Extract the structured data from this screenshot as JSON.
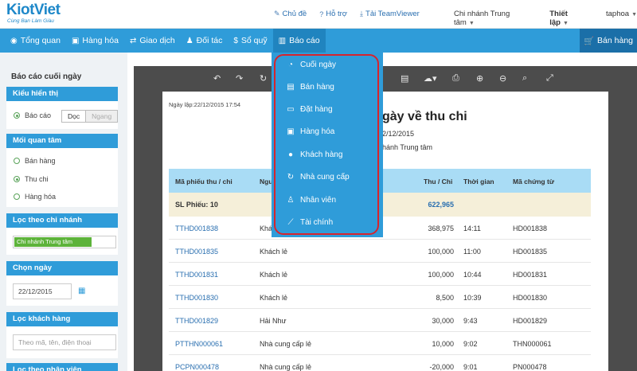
{
  "app": {
    "logo": "KiotViet",
    "slogan": "Cùng Bạn Làm Giàu"
  },
  "toplinks": [
    {
      "label": "Chủ đề",
      "icon": "brush-icon"
    },
    {
      "label": "Hỗ trợ",
      "icon": "help-circle-icon"
    },
    {
      "label": "Tải TeamViewer",
      "icon": "download-icon"
    }
  ],
  "topright": {
    "branch": "Chi nhánh Trung tâm",
    "settings": "Thiết lập",
    "user": "taphoa"
  },
  "nav": {
    "items": [
      {
        "label": "Tổng quan",
        "icon": "eye-icon"
      },
      {
        "label": "Hàng hóa",
        "icon": "box-icon"
      },
      {
        "label": "Giao dịch",
        "icon": "exchange-icon"
      },
      {
        "label": "Đối tác",
        "icon": "person-icon"
      },
      {
        "label": "Sổ quỹ",
        "icon": "dollar-icon"
      },
      {
        "label": "Báo cáo",
        "icon": "bar-chart-icon"
      }
    ],
    "sell": "Bán hàng"
  },
  "sidebar": {
    "title": "Báo cáo cuối ngày",
    "display": {
      "header": "Kiểu hiển thị",
      "option": "Báo cáo",
      "seg_vertical": "Dọc",
      "seg_horizontal": "Ngang"
    },
    "concern": {
      "header": "Mối quan tâm",
      "options": [
        "Bán hàng",
        "Thu chi",
        "Hàng hóa"
      ]
    },
    "branch_filter": {
      "header": "Lọc theo chi nhánh",
      "tag": "Chi nhánh Trung tâm"
    },
    "date": {
      "header": "Chọn ngày",
      "value": "22/12/2015"
    },
    "customer": {
      "header": "Lọc khách hàng",
      "placeholder": "Theo mã, tên, điện thoại"
    },
    "staff": {
      "header": "Lọc theo nhân viên"
    }
  },
  "report": {
    "print_date": "Ngày lập:22/12/2015 17:54",
    "title": "gày về thu chi",
    "sub_date": "2/12/2015",
    "sub_branch": "hánh Trung tâm",
    "columns": [
      "Mã phiếu thu / chi",
      "Ngư",
      "Thu / Chi",
      "Thời gian",
      "Mã chứng từ"
    ],
    "summary": {
      "label": "SL Phiếu: 10",
      "total": "622,965"
    },
    "rows": [
      {
        "code": "TTHD001838",
        "person": "Khá",
        "amount": "368,975",
        "time": "14:11",
        "ref": "HD001838"
      },
      {
        "code": "TTHD001835",
        "person": "Khách lẻ",
        "amount": "100,000",
        "time": "11:00",
        "ref": "HD001835"
      },
      {
        "code": "TTHD001831",
        "person": "Khách lẻ",
        "amount": "100,000",
        "time": "10:44",
        "ref": "HD001831"
      },
      {
        "code": "TTHD001830",
        "person": "Khách lẻ",
        "amount": "8,500",
        "time": "10:39",
        "ref": "HD001830"
      },
      {
        "code": "TTHD001829",
        "person": "Hải Như",
        "amount": "30,000",
        "time": "9:43",
        "ref": "HD001829"
      },
      {
        "code": "PTTHN000061",
        "person": "Nhà cung cấp lẻ",
        "amount": "10,000",
        "time": "9:02",
        "ref": "THN000061"
      },
      {
        "code": "PCPN000478",
        "person": "Nhà cung cấp lẻ",
        "amount": "-20,000",
        "time": "9:01",
        "ref": "PN000478"
      }
    ]
  },
  "dropdown": {
    "items": [
      {
        "label": "Cuối ngày",
        "icon": "pie-chart-icon"
      },
      {
        "label": "Bán hàng",
        "icon": "document-icon"
      },
      {
        "label": "Đặt hàng",
        "icon": "inbox-icon"
      },
      {
        "label": "Hàng hóa",
        "icon": "box-icon"
      },
      {
        "label": "Khách hàng",
        "icon": "person-icon"
      },
      {
        "label": "Nhà cung cấp",
        "icon": "refresh-icon"
      },
      {
        "label": "Nhân viên",
        "icon": "staff-icon"
      },
      {
        "label": "Tài chính",
        "icon": "line-chart-icon"
      }
    ],
    "highlight_color": "#d7242d"
  },
  "colors": {
    "primary": "#2f9cd9",
    "dark": "#1b6fa8",
    "green": "#5db33a"
  }
}
